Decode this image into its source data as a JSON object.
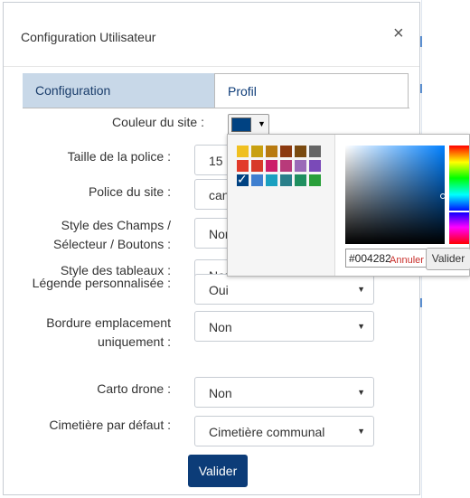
{
  "modal": {
    "title": "Configuration Utilisateur",
    "close_glyph": "×"
  },
  "tabs": [
    {
      "label": "Configuration",
      "active": true
    },
    {
      "label": "Profil",
      "active": false
    }
  ],
  "form": {
    "site_color": {
      "label": "Couleur du site :",
      "value": "#004282"
    },
    "font_size": {
      "label": "Taille de la police :",
      "value": "15"
    },
    "font_family": {
      "label": "Police du site :",
      "value": "canc"
    },
    "field_style": {
      "label_line1": "Style des Champs /",
      "label_line2": "Sélecteur / Boutons :",
      "value": "Non"
    },
    "table_style": {
      "label": "Style des tableaux :",
      "value": "Non"
    },
    "custom_legend": {
      "label": "Légende personnalisée :",
      "value": "Oui"
    },
    "border_only": {
      "label_line1": "Bordure emplacement",
      "label_line2": "uniquement :",
      "value": "Non"
    },
    "drone_map": {
      "label": "Carto drone :",
      "value": "Non"
    },
    "default_cemetery": {
      "label": "Cimetière par défaut :",
      "value": "Cimetière communal"
    },
    "submit_label": "Valider"
  },
  "color_picker": {
    "hex_value": "#004282",
    "cancel_label": "Annuler",
    "choose_label": "Valider",
    "palette_rows": [
      [
        "#f0c020",
        "#c8a010",
        "#b87a10",
        "#8c3a10",
        "#7a4a10",
        "#666666"
      ],
      [
        "#e23a2a",
        "#d83a2a",
        "#cc1e6a",
        "#b83a7a",
        "#9a6ab8",
        "#7a4ab8"
      ],
      [
        "#004282",
        "#3f7fd0",
        "#1aa0c0",
        "#2a7f8a",
        "#1f8f5f",
        "#2a9f3a"
      ]
    ],
    "selected_swatch": "#004282",
    "checkmark_glyph": "✓"
  },
  "icons": {
    "dropdown_arrow": "▼"
  }
}
